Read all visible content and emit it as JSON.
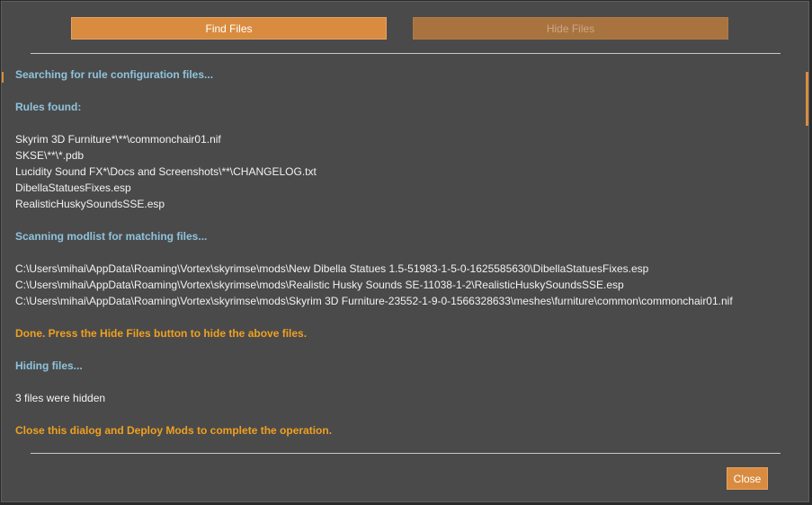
{
  "buttons": {
    "find_files": "Find Files",
    "hide_files": "Hide Files",
    "close": "Close"
  },
  "colors": {
    "accent": "#d98c3f",
    "accent_disabled": "#a97340",
    "status_text": "#8fc3dd",
    "notice_text": "#f0a020",
    "plain_text": "#f2f2f2",
    "dialog_bg": "#4a4a4a"
  },
  "log": {
    "searching": "Searching for rule configuration files...",
    "rules_found": "Rules found:",
    "rules": [
      "Skyrim 3D Furniture*\\**\\commonchair01.nif",
      "SKSE\\**\\*.pdb",
      "Lucidity Sound FX*\\Docs and Screenshots\\**\\CHANGELOG.txt",
      "DibellaStatuesFixes.esp",
      "RealisticHuskySoundsSSE.esp"
    ],
    "scanning": "Scanning modlist for matching files...",
    "matches": [
      "C:\\Users\\mihai\\AppData\\Roaming\\Vortex\\skyrimse\\mods\\New Dibella Statues 1.5-51983-1-5-0-1625585630\\DibellaStatuesFixes.esp",
      "C:\\Users\\mihai\\AppData\\Roaming\\Vortex\\skyrimse\\mods\\Realistic Husky Sounds SE-11038-1-2\\RealisticHuskySoundsSSE.esp",
      "C:\\Users\\mihai\\AppData\\Roaming\\Vortex\\skyrimse\\mods\\Skyrim 3D Furniture-23552-1-9-0-1566328633\\meshes\\furniture\\common\\commonchair01.nif"
    ],
    "done": "Done. Press the Hide Files button to hide the above files.",
    "hiding": "Hiding files...",
    "hidden_count": "3 files were hidden",
    "close_notice": "Close this dialog and Deploy Mods to complete the operation."
  }
}
